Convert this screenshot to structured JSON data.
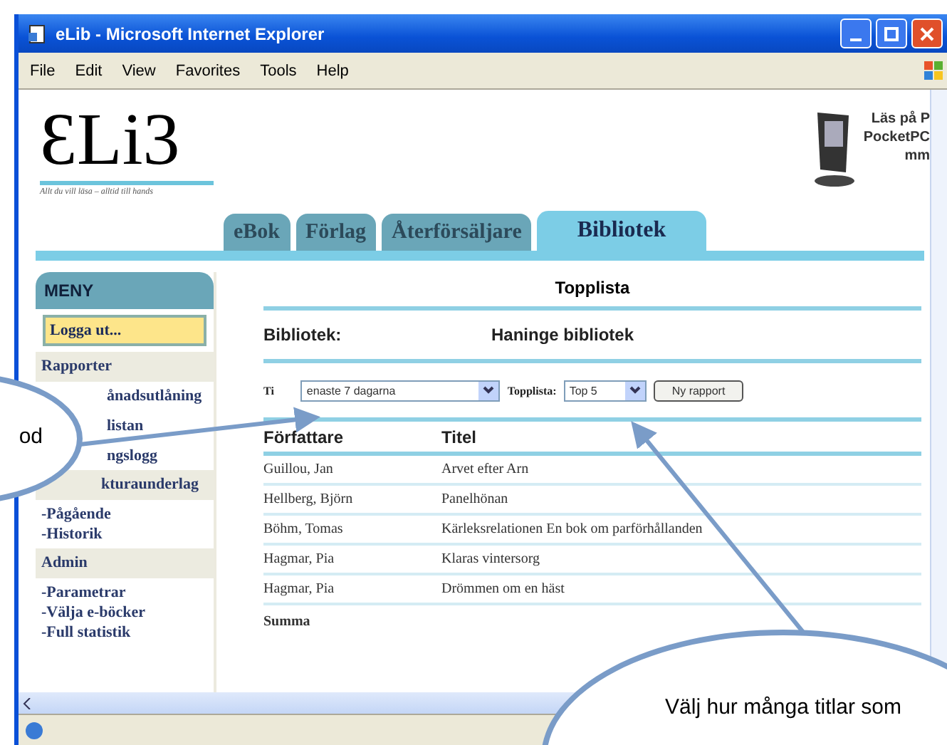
{
  "window": {
    "title": "eLib - Microsoft Internet Explorer"
  },
  "menu_bar": [
    "File",
    "Edit",
    "View",
    "Favorites",
    "Tools",
    "Help"
  ],
  "header": {
    "logo": "ƐLi3",
    "tagline": "Allt du vill läsa – alltid till hands",
    "promo": [
      "Läs på P",
      "PocketPC",
      "mm"
    ]
  },
  "tabs": [
    {
      "label": "eBok",
      "selected": false
    },
    {
      "label": "Förlag",
      "selected": false
    },
    {
      "label": "Återförsäljare",
      "selected": false
    },
    {
      "label": "Bibliotek",
      "selected": true
    }
  ],
  "sidebar": {
    "title": "MENY",
    "logout": "Logga ut...",
    "sections": [
      {
        "heading": "Rapporter",
        "items": [
          "ånadsutlåning",
          "listan",
          "ngslogg"
        ]
      },
      {
        "heading": "kturaunderlag",
        "items": [
          "-Pågående",
          "-Historik"
        ]
      },
      {
        "heading": "Admin",
        "items": [
          "-Parametrar",
          "-Välja e-böcker",
          "-Full statistik"
        ]
      }
    ]
  },
  "report": {
    "title": "Topplista",
    "library_label": "Bibliotek:",
    "library_name": "Haninge bibliotek",
    "period_label": "Ti",
    "period_value": "enaste 7 dagarna",
    "top_label": "Topplista:",
    "top_value": "Top 5",
    "button": "Ny rapport",
    "columns": [
      "Författare",
      "Titel"
    ],
    "rows": [
      [
        "Guillou, Jan",
        "Arvet efter Arn"
      ],
      [
        "Hellberg, Björn",
        "Panelhönan"
      ],
      [
        "Böhm, Tomas",
        "Kärleksrelationen En bok om parförhållanden"
      ],
      [
        "Hagmar, Pia",
        "Klaras vintersorg"
      ],
      [
        "Hagmar, Pia",
        "Drömmen om en häst"
      ]
    ],
    "total_label": "Summa"
  },
  "callouts": [
    {
      "text": "od"
    },
    {
      "text": "Välj hur många titlar som"
    }
  ]
}
